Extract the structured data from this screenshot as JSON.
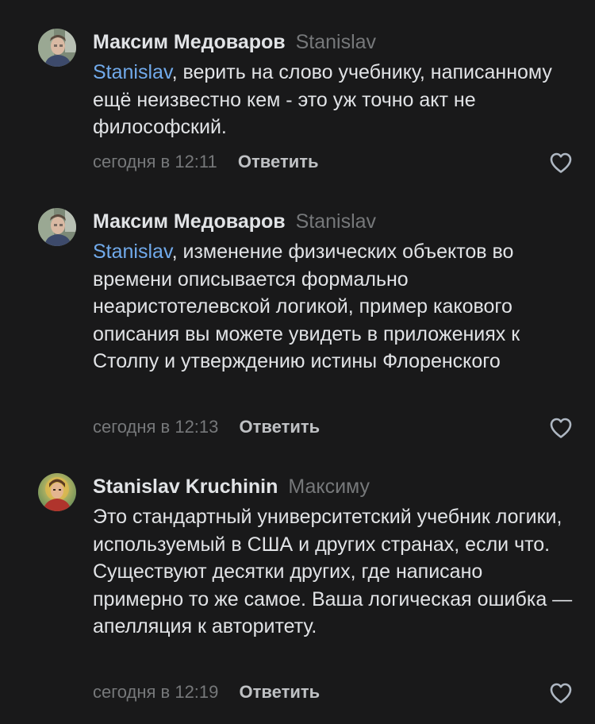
{
  "comments": [
    {
      "author": "Максим Медоваров",
      "reply_to": "Stanislav",
      "mention": "Stanislav",
      "text": ", верить на слово учебнику, написанному ещё неизвестно кем - это уж точно акт не философский.",
      "time": "сегодня в 12:11",
      "reply_label": "Ответить",
      "avatar_icon": "user-photo-avatar",
      "like_icon": "heart-outline-icon"
    },
    {
      "author": "Максим Медоваров",
      "reply_to": "Stanislav",
      "mention": "Stanislav",
      "text": ", изменение физических объектов во времени описывается формально неаристотелевской логикой, пример какового описания вы можете увидеть в приложениях к Столпу и утверждению истины Флоренского",
      "time": "сегодня в 12:13",
      "reply_label": "Ответить",
      "avatar_icon": "user-photo-avatar",
      "like_icon": "heart-outline-icon"
    },
    {
      "author": "Stanislav Kruchinin",
      "reply_to": "Максиму",
      "mention": "",
      "text": "Это стандартный университетский учебник логики, используемый в США и других странах, если что. Существуют десятки других, где написано примерно то же самое. Ваша логическая ошибка — апелляция к авторитету.",
      "time": "сегодня в 12:19",
      "reply_label": "Ответить",
      "avatar_icon": "illustrated-portrait-avatar",
      "like_icon": "heart-outline-icon"
    }
  ],
  "colors": {
    "background": "#19191a",
    "text": "#e1e3e6",
    "secondary": "#76787a",
    "mention": "#71aaeb"
  }
}
